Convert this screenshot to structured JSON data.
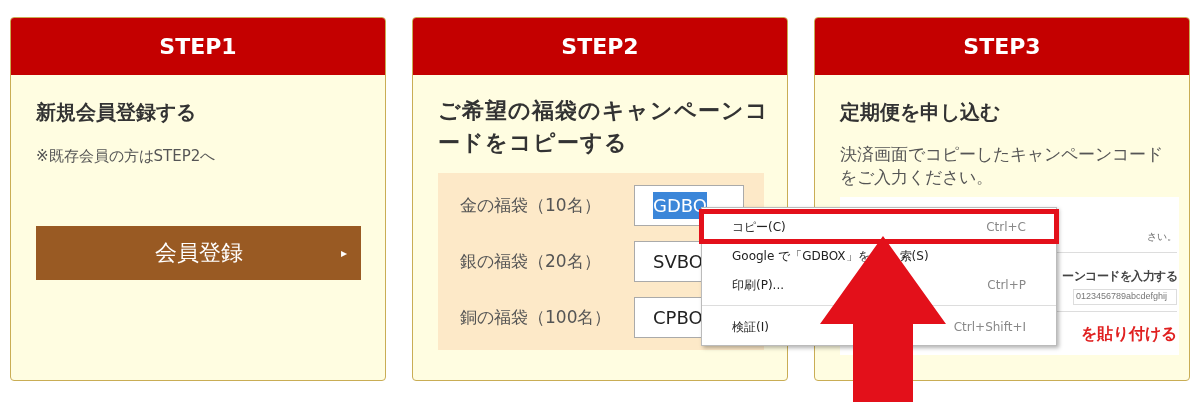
{
  "steps": [
    {
      "kind": "register",
      "header": "STEP1",
      "title": "新規会員登録する",
      "note": "※既存会員の方はSTEP2へ",
      "button": {
        "label": "会員登録",
        "arrow": "▸"
      }
    },
    {
      "kind": "codes",
      "header": "STEP2",
      "title": "ご希望の福袋のキャンペーンコードをコピーする",
      "codes": [
        {
          "label": "金の福袋（10名）",
          "value": "GDBO",
          "selected": true
        },
        {
          "label": "銀の福袋（20名）",
          "value": "SVBO",
          "selected": false
        },
        {
          "label": "銅の福袋（100名）",
          "value": "CPBO",
          "selected": false
        }
      ]
    },
    {
      "kind": "paste",
      "header": "STEP3",
      "title": "定期便を申し込む",
      "text": "決済画面でコピーしたキャンペーンコードをご入力ください。",
      "screenshot": {
        "notice": "さい。",
        "field_label": "ーンコードを入力する",
        "field_value": "0123456789abcdefghij",
        "caption": "を貼り付ける"
      }
    }
  ],
  "context_menu": {
    "items": [
      {
        "label": "コピー(C)",
        "shortcut": "Ctrl+C",
        "highlighted": true
      },
      {
        "label": "Google で「GDBOX」を",
        "label_end": "索(S)",
        "highlighted": false
      },
      {
        "label": "印刷(P)...",
        "shortcut": "Ctrl+P",
        "highlighted": false
      },
      {
        "label": "検証(I)",
        "shortcut": "Ctrl+Shift+I",
        "highlighted": false,
        "separator_before": true
      }
    ]
  }
}
